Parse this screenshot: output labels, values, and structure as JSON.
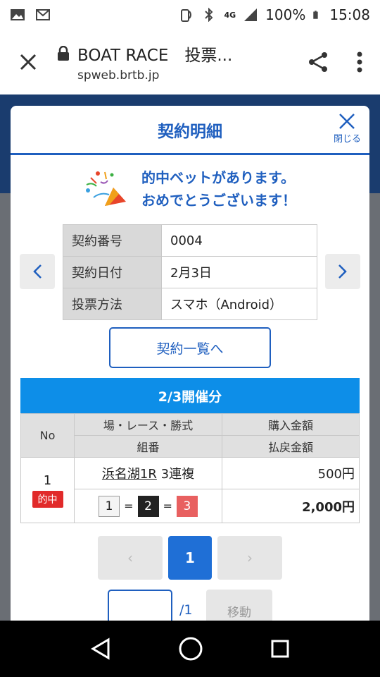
{
  "status_bar": {
    "network": "4G",
    "battery": "100%",
    "time": "15:08"
  },
  "browser": {
    "title": "BOAT RACE　投票...",
    "domain": "spweb.brtb.jp"
  },
  "modal": {
    "title": "契約明細",
    "close_label": "閉じる",
    "congrats_line1": "的中ベットがあります。",
    "congrats_line2": "おめでとうございます！",
    "info": [
      {
        "key": "契約番号",
        "value": "0004"
      },
      {
        "key": "契約日付",
        "value": "2月3日"
      },
      {
        "key": "投票方法",
        "value": "スマホ（Android）"
      }
    ],
    "list_button": "契約一覧へ",
    "day_header": "2/3開催分",
    "table_headers": {
      "no": "No",
      "race": "場・レース・勝式",
      "purchase": "購入金額",
      "combo": "組番",
      "payout": "払戻金額"
    },
    "bets": [
      {
        "no": "1",
        "badge": "的中",
        "race": "浜名湖1R",
        "type": "3連複",
        "purchase": "500円",
        "combo": [
          "1",
          "2",
          "3"
        ],
        "combo_sep": "=",
        "payout": "2,000円"
      }
    ],
    "pager": {
      "current": "1",
      "prev": "‹",
      "next": "›"
    },
    "jump": {
      "value": "",
      "total": "/1",
      "button": "移動"
    }
  }
}
